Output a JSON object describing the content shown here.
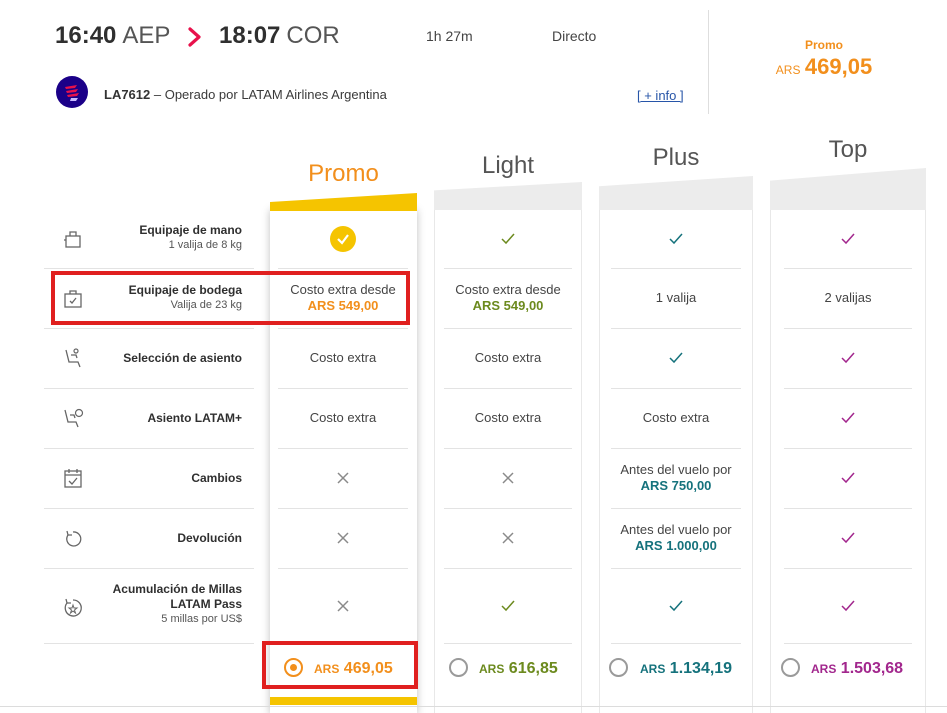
{
  "flight": {
    "departure_time": "16:40",
    "departure_code": "AEP",
    "arrival_time": "18:07",
    "arrival_code": "COR",
    "duration": "1h 27m",
    "stops": "Directo",
    "flight_number": "LA7612",
    "operated_by": "– Operado por LATAM Airlines Argentina",
    "more_info": "[ + info ]",
    "selected_fare_name": "Promo",
    "selected_fare_currency": "ARS",
    "selected_fare_amount": "469,05"
  },
  "fares": [
    {
      "name": "Promo",
      "color": "#f28f1c"
    },
    {
      "name": "Light",
      "color": "#6c8a1e"
    },
    {
      "name": "Plus",
      "color": "#15727c"
    },
    {
      "name": "Top",
      "color": "#a2278d"
    }
  ],
  "features": [
    {
      "title": "Equipaje de mano",
      "subtitle": "1 valija de 8 kg",
      "icon": "carry-on-bag-icon"
    },
    {
      "title": "Equipaje de bodega",
      "subtitle": "Valija de 23 kg",
      "icon": "checked-bag-icon"
    },
    {
      "title": "Selección de asiento",
      "subtitle": "",
      "icon": "seat-icon"
    },
    {
      "title": "Asiento LATAM+",
      "subtitle": "",
      "icon": "seat-plus-icon"
    },
    {
      "title": "Cambios",
      "subtitle": "",
      "icon": "calendar-check-icon"
    },
    {
      "title": "Devolución",
      "subtitle": "",
      "icon": "refund-icon"
    },
    {
      "title_line1": "Acumulación de Millas",
      "title_line2": "LATAM Pass",
      "subtitle": "5 millas por US$",
      "icon": "miles-accrual-icon"
    }
  ],
  "cells": {
    "bodega": {
      "promo_text": "Costo extra desde",
      "promo_price": "ARS 549,00",
      "light_text": "Costo extra desde",
      "light_price": "ARS 549,00",
      "plus_text": "1 valija",
      "top_text": "2 valijas"
    },
    "seat": {
      "promo_text": "Costo extra",
      "light_text": "Costo extra"
    },
    "seat_plus": {
      "promo_text": "Costo extra",
      "light_text": "Costo extra",
      "plus_text": "Costo extra"
    },
    "changes": {
      "plus_text": "Antes del vuelo por",
      "plus_price": "ARS 750,00"
    },
    "refund": {
      "plus_text": "Antes del vuelo por",
      "plus_price": "ARS 1.000,00"
    }
  },
  "prices": [
    {
      "currency": "ARS",
      "amount": "469,05",
      "selected": true
    },
    {
      "currency": "ARS",
      "amount": "616,85",
      "selected": false
    },
    {
      "currency": "ARS",
      "amount": "1.134,19",
      "selected": false
    },
    {
      "currency": "ARS",
      "amount": "1.503,68",
      "selected": false
    }
  ]
}
